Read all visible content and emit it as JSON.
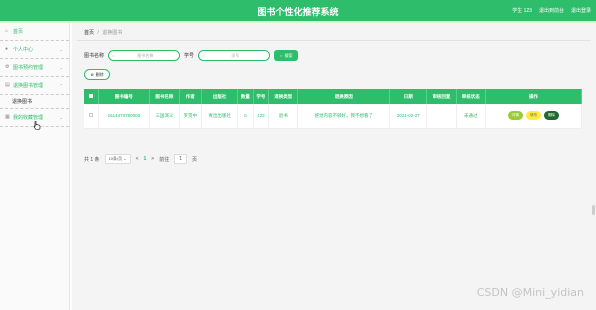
{
  "header": {
    "title": "图书个性化推荐系统",
    "links": [
      "学生 123",
      "退出到前台",
      "退出登录"
    ]
  },
  "sidebar": {
    "items": [
      {
        "icon": "home-icon",
        "label": "首页"
      },
      {
        "icon": "user-icon",
        "label": "个人中心"
      },
      {
        "icon": "gear-icon",
        "label": "图书预约管理"
      },
      {
        "icon": "book-icon",
        "label": "退换图书管理"
      }
    ],
    "sub_item": "退换图书",
    "last_item": {
      "icon": "list-icon",
      "label": "我的收藏管理"
    }
  },
  "breadcrumb": {
    "home": "首页",
    "sep": "/",
    "current": "退换图书"
  },
  "search": {
    "label1": "图书名称",
    "placeholder1": "图书名称",
    "label2": "学号",
    "placeholder2": "学号",
    "button": "搜索"
  },
  "delete_button": "删除",
  "table": {
    "headers": [
      "图书编号",
      "图书名称",
      "作者",
      "出版社",
      "数量",
      "学号",
      "退换类型",
      "退换原因",
      "日期",
      "审核回复",
      "审核状态",
      "操作"
    ],
    "rows": [
      [
        "1614473780000",
        "三国演义",
        "罗贯中",
        "青出出版社",
        "0",
        "123",
        "退书",
        "感觉内容不够好，我不想看了",
        "2021-02-27",
        "",
        "未通过"
      ]
    ],
    "actions": [
      "详情",
      "修改",
      "删除"
    ]
  },
  "pagination": {
    "total": "共 1 条",
    "per_page": "10条/页",
    "prev": "<",
    "current": "1",
    "next": ">",
    "goto_label": "前往",
    "goto_value": "1",
    "page_unit": "页"
  },
  "watermark": "CSDN @Mini_yidian",
  "colors": {
    "accent": "#2ebd6b"
  }
}
